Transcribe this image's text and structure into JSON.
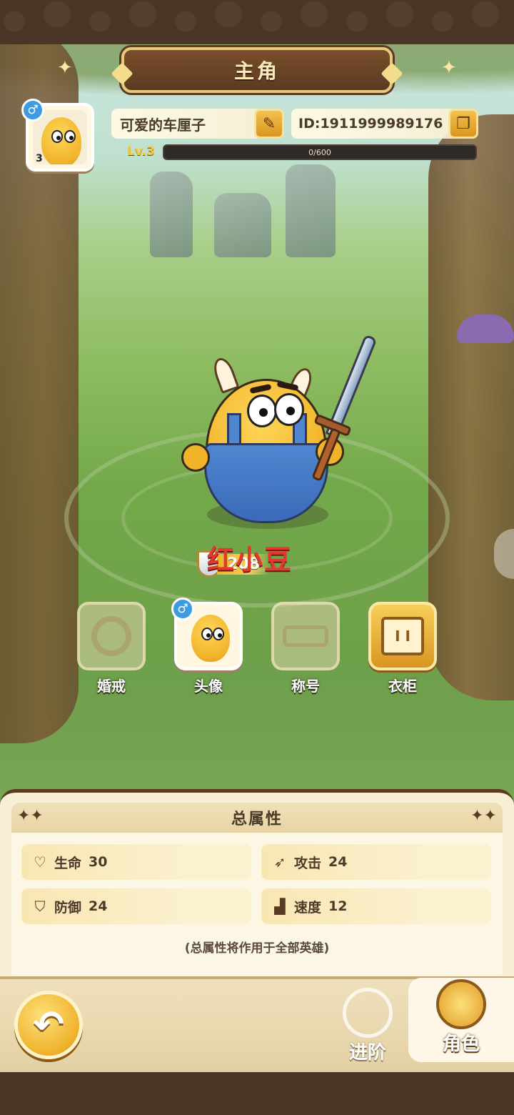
{
  "page": {
    "title": "主角"
  },
  "profile": {
    "avatar_level": "3",
    "gender_symbol": "♂",
    "name": "可爱的车厘子",
    "id_text": "ID:1911999989176",
    "level_label": "Lv.3",
    "xp_text": "0/600",
    "xp_fraction": 0
  },
  "hero": {
    "name": "红小豆",
    "power": "208"
  },
  "functions": [
    {
      "label": "婚戒",
      "icon": "ring-icon",
      "state": "locked"
    },
    {
      "label": "头像",
      "icon": "avatar-icon",
      "state": "active"
    },
    {
      "label": "称号",
      "icon": "title-crown-icon",
      "state": "locked"
    },
    {
      "label": "衣柜",
      "icon": "wardrobe-icon",
      "state": "gold"
    }
  ],
  "attributes": {
    "title": "总属性",
    "stats": [
      {
        "icon": "heart-icon",
        "label": "生命",
        "value": "30"
      },
      {
        "icon": "attack-icon",
        "label": "攻击",
        "value": "24"
      },
      {
        "icon": "shield-icon",
        "label": "防御",
        "value": "24"
      },
      {
        "icon": "boot-icon",
        "label": "速度",
        "value": "12"
      }
    ],
    "note": "(总属性将作用于全部英雄)"
  },
  "nav": {
    "advance_label": "进阶",
    "role_label": "角色"
  },
  "colors": {
    "accent_gold": "#f2c83a",
    "hero_name_red": "#e13a2e",
    "gender_blue": "#3d9be4"
  }
}
